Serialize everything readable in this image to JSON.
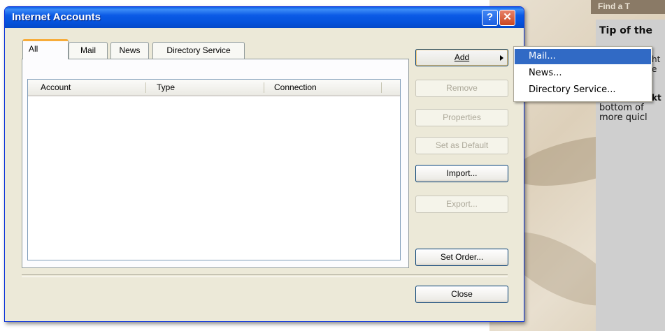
{
  "background": {
    "top_label": "Find a T",
    "tip_title": "Tip of the",
    "tip_fragments": [
      "ht",
      "e",
      "kt"
    ],
    "tip_body": [
      "bottom of",
      "more quicl"
    ]
  },
  "dialog": {
    "title": "Internet Accounts",
    "help_glyph": "?",
    "close_glyph": "✕",
    "tabs": [
      {
        "label": "All",
        "active": true
      },
      {
        "label": "Mail",
        "active": false
      },
      {
        "label": "News",
        "active": false
      },
      {
        "label": "Directory Service",
        "active": false
      }
    ],
    "columns": [
      "Account",
      "Type",
      "Connection"
    ],
    "buttons": {
      "add": "Add",
      "remove": "Remove",
      "properties": "Properties",
      "set_default": "Set as Default",
      "import": "Import...",
      "export": "Export...",
      "set_order": "Set Order...",
      "close": "Close"
    }
  },
  "add_menu": {
    "items": [
      "Mail...",
      "News...",
      "Directory Service..."
    ],
    "highlighted_index": 0
  },
  "colors": {
    "titlebar": "#0553dd",
    "menu_highlight": "#316ac5",
    "dialog_face": "#ece9d8"
  }
}
